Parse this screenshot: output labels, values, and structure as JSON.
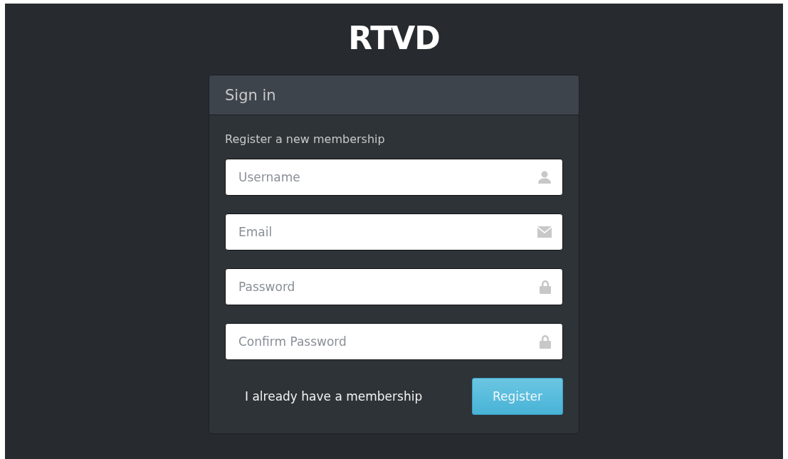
{
  "logo": "RTVD",
  "card": {
    "title": "Sign in",
    "subtitle": "Register a new membership",
    "fields": [
      {
        "placeholder": "Username",
        "kind": "user"
      },
      {
        "placeholder": "Email",
        "kind": "email"
      },
      {
        "placeholder": "Password",
        "kind": "lock"
      },
      {
        "placeholder": "Confirm Password",
        "kind": "lock"
      }
    ],
    "link": "I already have a membership",
    "button": "Register"
  }
}
